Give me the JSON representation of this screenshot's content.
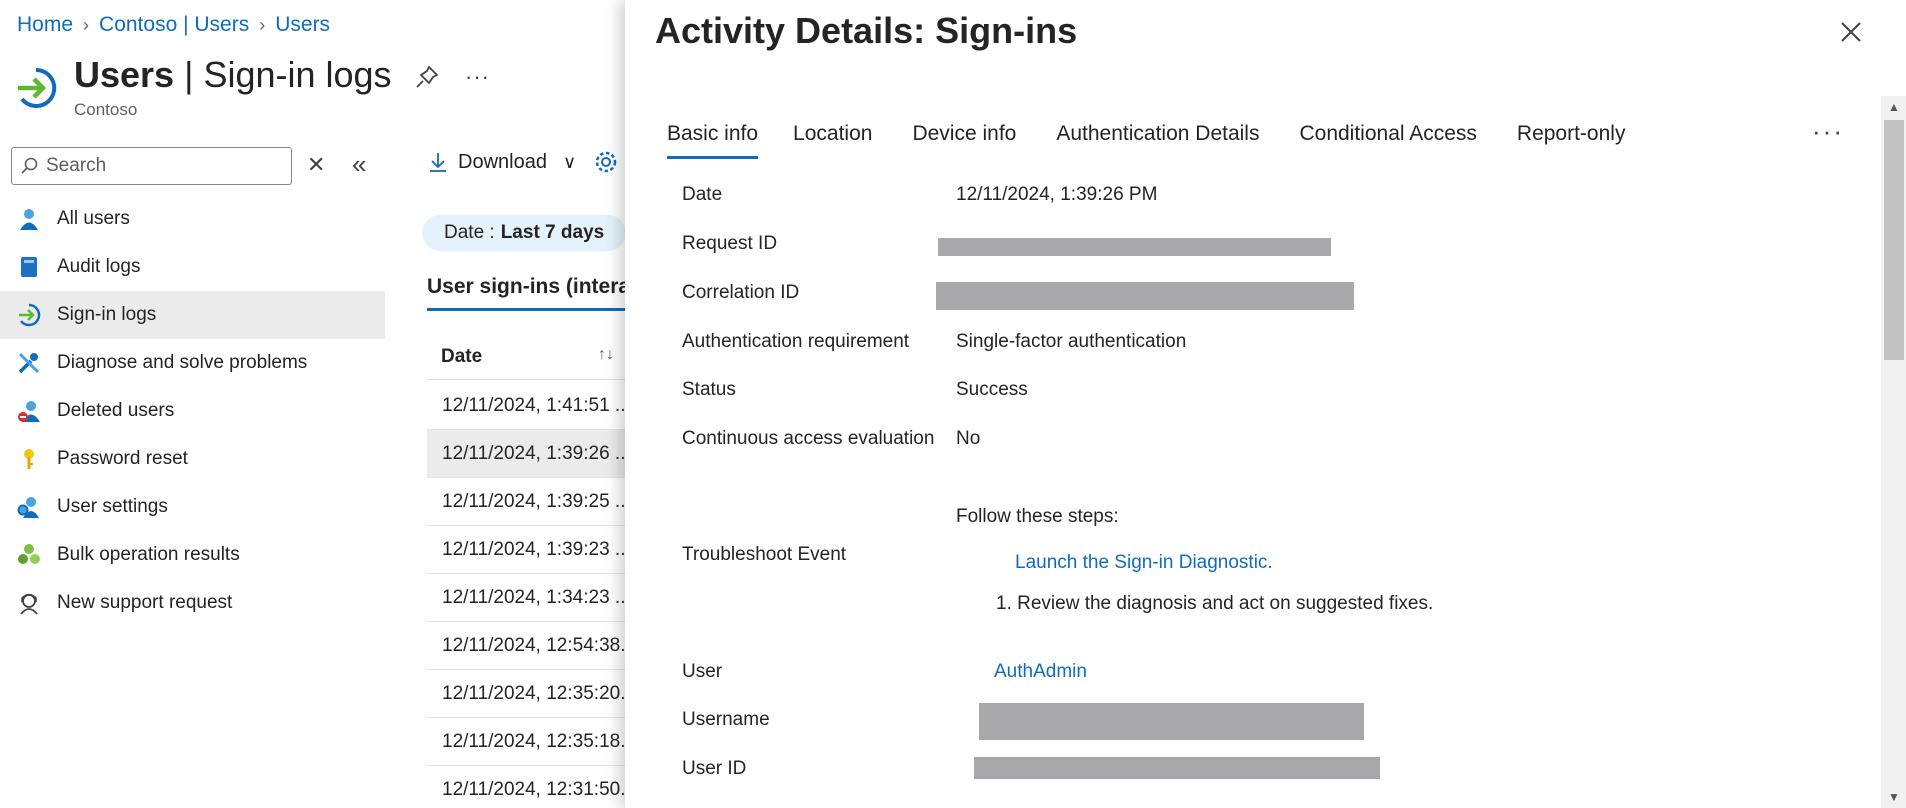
{
  "breadcrumb": [
    "Home",
    "Contoso | Users",
    "Users"
  ],
  "page": {
    "title_bold": "Users",
    "title_sep": " | ",
    "title_rest": "Sign-in logs",
    "subtitle": "Contoso"
  },
  "search": {
    "placeholder": "Search"
  },
  "sidebar": {
    "items": [
      {
        "label": "All users",
        "icon": "user-icon"
      },
      {
        "label": "Audit logs",
        "icon": "book-icon"
      },
      {
        "label": "Sign-in logs",
        "icon": "sign-in-icon",
        "active": true
      },
      {
        "label": "Diagnose and solve problems",
        "icon": "wrench-icon"
      },
      {
        "label": "Deleted users",
        "icon": "deleted-user-icon"
      },
      {
        "label": "Password reset",
        "icon": "key-icon"
      },
      {
        "label": "User settings",
        "icon": "user-settings-icon"
      },
      {
        "label": "Bulk operation results",
        "icon": "bulk-icon"
      },
      {
        "label": "New support request",
        "icon": "support-icon"
      }
    ]
  },
  "toolbar": {
    "download_label": "Download"
  },
  "filter": {
    "date_label": "Date :",
    "date_value": "Last 7 days"
  },
  "list": {
    "tab_label": "User sign-ins (interac",
    "column_header": "Date",
    "rows": [
      "12/11/2024, 1:41:51 ...",
      "12/11/2024, 1:39:26 ...",
      "12/11/2024, 1:39:25 ...",
      "12/11/2024, 1:39:23 ...",
      "12/11/2024, 1:34:23 ...",
      "12/11/2024, 12:54:38...",
      "12/11/2024, 12:35:20...",
      "12/11/2024, 12:35:18...",
      "12/11/2024, 12:31:50..."
    ]
  },
  "panel": {
    "title": "Activity Details: Sign-ins",
    "tabs": [
      "Basic info",
      "Location",
      "Device info",
      "Authentication Details",
      "Conditional Access",
      "Report-only"
    ],
    "fields": {
      "date_label": "Date",
      "date_value": "12/11/2024, 1:39:26 PM",
      "request_id_label": "Request ID",
      "correlation_id_label": "Correlation ID",
      "auth_req_label": "Authentication requirement",
      "auth_req_value": "Single-factor authentication",
      "status_label": "Status",
      "status_value": "Success",
      "cae_label": "Continuous access evaluation",
      "cae_value": "No",
      "troubleshoot_label": "Troubleshoot Event",
      "troubleshoot_heading": "Follow these steps:",
      "troubleshoot_link": "Launch the Sign-in Diagnostic.",
      "troubleshoot_step": "1. Review the diagnosis and act on suggested fixes.",
      "user_label": "User",
      "user_value": "AuthAdmin",
      "username_label": "Username",
      "user_id_label": "User ID"
    }
  },
  "colors": {
    "accent": "#0f6cbd",
    "redaction": "#a8a8ab",
    "selected_row": "#ebebeb"
  }
}
